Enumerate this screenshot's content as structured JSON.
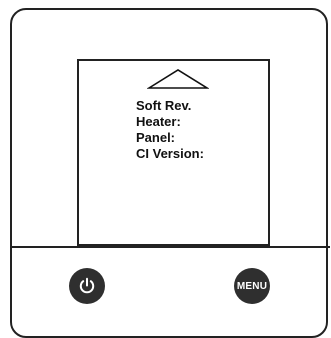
{
  "screen": {
    "nav": {
      "icon": "up-arrow-icon"
    },
    "lines": [
      "Soft Rev.",
      "Heater:",
      "Panel:",
      "CI Version:"
    ]
  },
  "buttons": {
    "power": {
      "icon": "power-icon"
    },
    "menu": {
      "label": "MENU"
    }
  },
  "colors": {
    "outline": "#222222",
    "button": "#2f2f2f",
    "button_text": "#ffffff",
    "background": "#ffffff"
  }
}
